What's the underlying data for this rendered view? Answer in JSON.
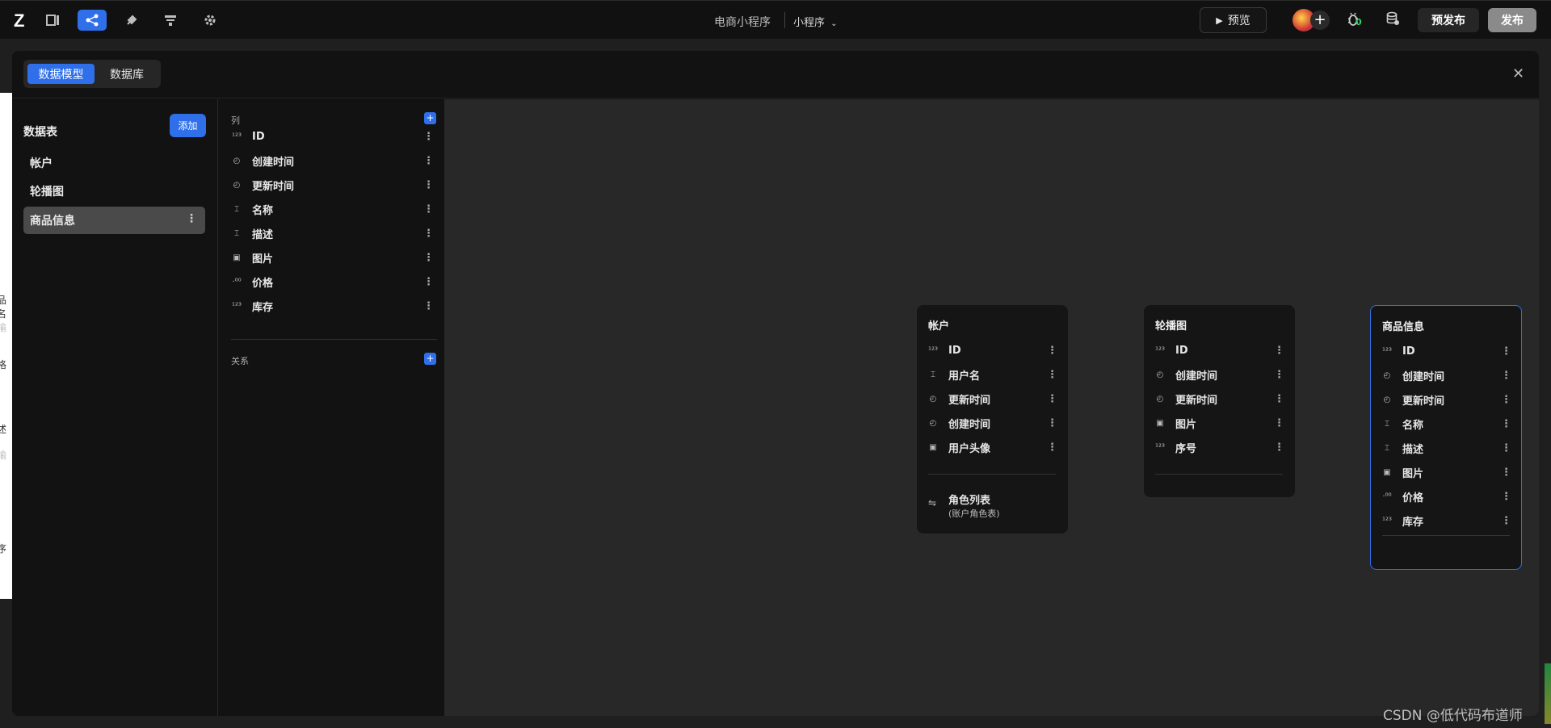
{
  "topbar": {
    "logo": "Z",
    "app_title": "电商小程序",
    "app_type": "小程序",
    "app_type_caret": "⌄",
    "preview_label": "预览",
    "preview_icon": "▶",
    "bug_badge": "0",
    "prepublish_label": "预发布",
    "publish_label": "发布",
    "icons": [
      "layout-icon",
      "data-model-icon",
      "plugin-icon",
      "workflow-icon",
      "settings-icon"
    ]
  },
  "modal": {
    "tabs": [
      {
        "label": "数据模型",
        "active": true
      },
      {
        "label": "数据库",
        "active": false
      }
    ],
    "close": "✕"
  },
  "tables_panel": {
    "title": "数据表",
    "add_label": "添加",
    "items": [
      {
        "label": "帐户"
      },
      {
        "label": "轮播图"
      },
      {
        "label": "商品信息",
        "selected": true
      }
    ]
  },
  "columns_panel": {
    "columns_title": "列",
    "relations_title": "关系",
    "columns": [
      {
        "label": "ID",
        "type": "number"
      },
      {
        "label": "创建时间",
        "type": "time"
      },
      {
        "label": "更新时间",
        "type": "time"
      },
      {
        "label": "名称",
        "type": "text"
      },
      {
        "label": "描述",
        "type": "text"
      },
      {
        "label": "图片",
        "type": "image"
      },
      {
        "label": "价格",
        "type": "decimal"
      },
      {
        "label": "库存",
        "type": "number"
      }
    ]
  },
  "canvas": {
    "entities": [
      {
        "title": "帐户",
        "fields": [
          {
            "label": "ID",
            "type": "number"
          },
          {
            "label": "用户名",
            "type": "text"
          },
          {
            "label": "更新时间",
            "type": "time"
          },
          {
            "label": "创建时间",
            "type": "time"
          },
          {
            "label": "用户头像",
            "type": "image"
          }
        ],
        "relation": {
          "title": "角色列表",
          "subtitle": "(账户角色表)"
        }
      },
      {
        "title": "轮播图",
        "fields": [
          {
            "label": "ID",
            "type": "number"
          },
          {
            "label": "创建时间",
            "type": "time"
          },
          {
            "label": "更新时间",
            "type": "time"
          },
          {
            "label": "图片",
            "type": "image"
          },
          {
            "label": "序号",
            "type": "number"
          }
        ]
      },
      {
        "title": "商品信息",
        "fields": [
          {
            "label": "ID",
            "type": "number"
          },
          {
            "label": "创建时间",
            "type": "time"
          },
          {
            "label": "更新时间",
            "type": "time"
          },
          {
            "label": "名称",
            "type": "text"
          },
          {
            "label": "描述",
            "type": "text"
          },
          {
            "label": "图片",
            "type": "image"
          },
          {
            "label": "价格",
            "type": "decimal"
          },
          {
            "label": "库存",
            "type": "number"
          }
        ]
      }
    ]
  },
  "background_fragments": [
    "品名",
    "输",
    "格",
    "述",
    "输",
    "序"
  ],
  "watermark": "CSDN @低代码布道师",
  "colors": {
    "accent": "#2f6fea",
    "background": "#121212",
    "canvas": "#282828"
  }
}
